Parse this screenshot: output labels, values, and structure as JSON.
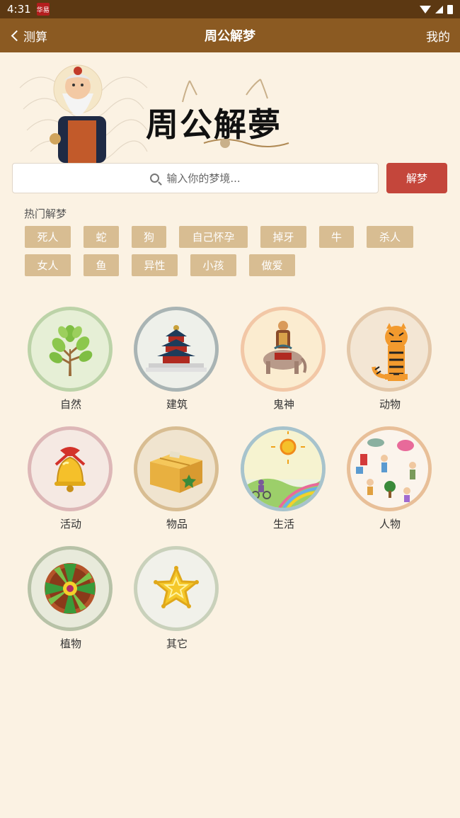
{
  "status_bar": {
    "time": "4:31",
    "app_icon_text": "华易"
  },
  "nav": {
    "back_label": "测算",
    "title": "周公解梦",
    "right_label": "我的"
  },
  "banner": {
    "title": "周公解夢"
  },
  "search": {
    "placeholder": "输入你的梦境...",
    "button_label": "解梦"
  },
  "hot": {
    "title": "热门解梦",
    "tags": [
      "死人",
      "蛇",
      "狗",
      "自己怀孕",
      "掉牙",
      "牛",
      "杀人",
      "女人",
      "鱼",
      "异性",
      "小孩",
      "做爱"
    ]
  },
  "categories": [
    {
      "label": "自然",
      "icon": "tree-icon",
      "ring": "#bcd3a8",
      "fill": "#e6efd6"
    },
    {
      "label": "建筑",
      "icon": "temple-icon",
      "ring": "#a9b4b4",
      "fill": "#eef0ea"
    },
    {
      "label": "鬼神",
      "icon": "deity-icon",
      "ring": "#f2c7a6",
      "fill": "#fbecd0"
    },
    {
      "label": "动物",
      "icon": "tiger-icon",
      "ring": "#e3c7a8",
      "fill": "#f3e6d4"
    },
    {
      "label": "活动",
      "icon": "bell-icon",
      "ring": "#ddb7b7",
      "fill": "#f5e9e3"
    },
    {
      "label": "物品",
      "icon": "box-icon",
      "ring": "#d8bd92",
      "fill": "#f0e4cf"
    },
    {
      "label": "生活",
      "icon": "landscape-icon",
      "ring": "#a7c3cc",
      "fill": "#edf2e0"
    },
    {
      "label": "人物",
      "icon": "people-icon",
      "ring": "#e8bf98",
      "fill": "#fbf4ec"
    },
    {
      "label": "植物",
      "icon": "potted-plant-icon",
      "ring": "#b7c2a7",
      "fill": "#e8eadb"
    },
    {
      "label": "其它",
      "icon": "star-icon",
      "ring": "#c9d1bb",
      "fill": "#f1f1ea"
    }
  ]
}
